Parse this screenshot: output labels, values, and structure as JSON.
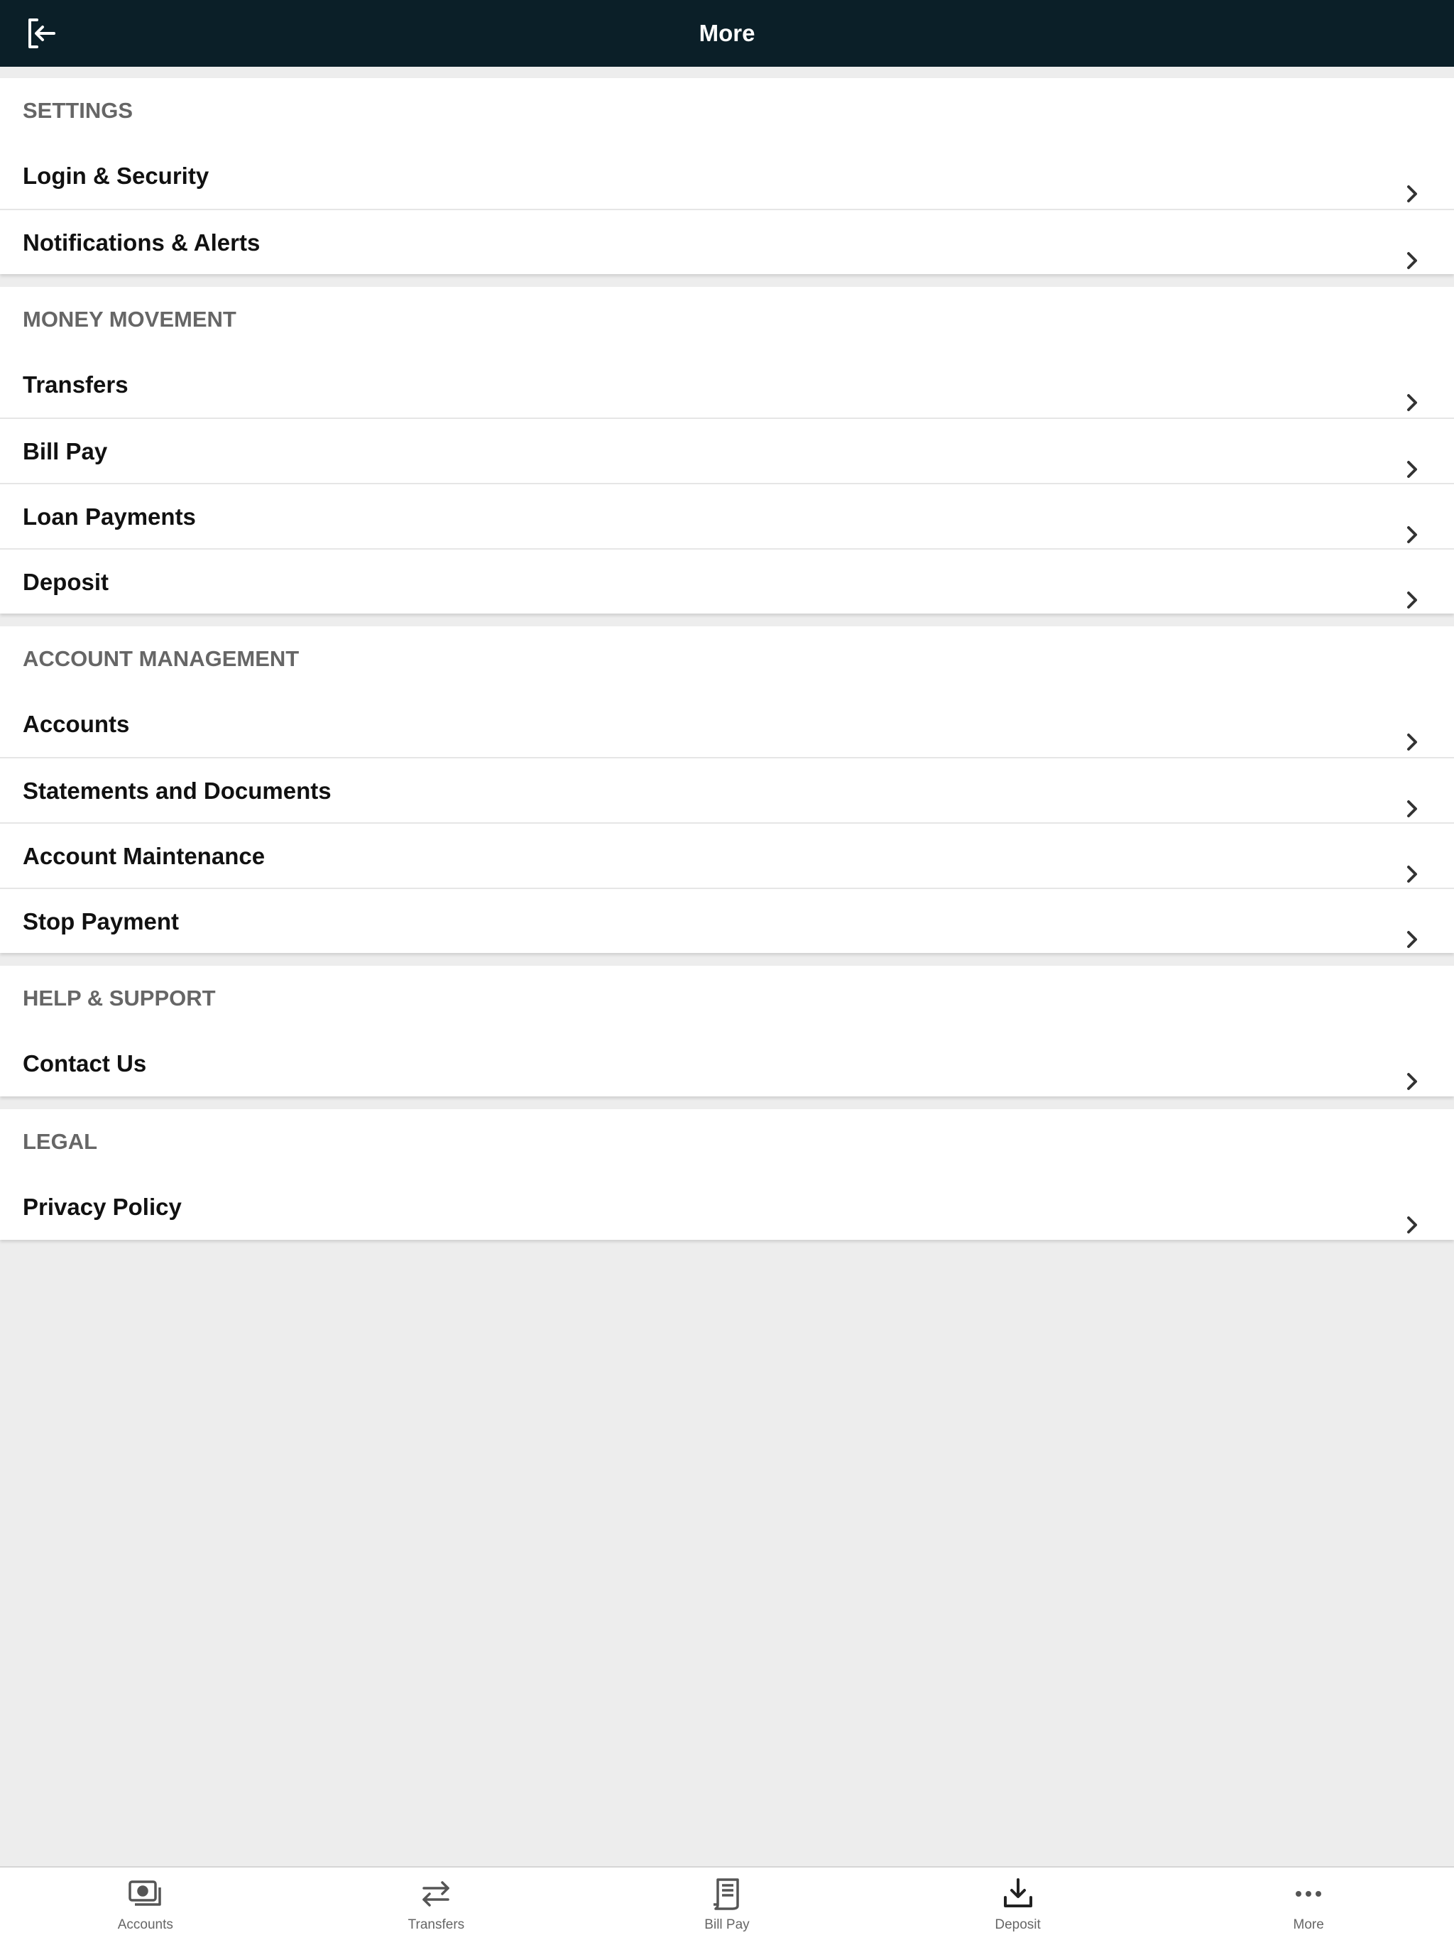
{
  "header": {
    "title": "More",
    "logout_icon": "logout-icon"
  },
  "sections": [
    {
      "title": "SETTINGS",
      "items": [
        {
          "label": "Login & Security"
        },
        {
          "label": "Notifications & Alerts"
        }
      ]
    },
    {
      "title": "MONEY MOVEMENT",
      "items": [
        {
          "label": "Transfers"
        },
        {
          "label": "Bill Pay"
        },
        {
          "label": "Loan Payments"
        },
        {
          "label": "Deposit"
        }
      ]
    },
    {
      "title": "ACCOUNT MANAGEMENT",
      "items": [
        {
          "label": "Accounts"
        },
        {
          "label": "Statements and Documents"
        },
        {
          "label": "Account Maintenance"
        },
        {
          "label": "Stop Payment"
        }
      ]
    },
    {
      "title": "HELP & SUPPORT",
      "items": [
        {
          "label": "Contact Us"
        }
      ]
    },
    {
      "title": "LEGAL",
      "items": [
        {
          "label": "Privacy Policy"
        }
      ]
    }
  ],
  "tabbar": {
    "tabs": [
      {
        "label": "Accounts",
        "icon": "accounts-icon"
      },
      {
        "label": "Transfers",
        "icon": "transfers-icon"
      },
      {
        "label": "Bill Pay",
        "icon": "bill-pay-icon"
      },
      {
        "label": "Deposit",
        "icon": "deposit-icon"
      },
      {
        "label": "More",
        "icon": "more-icon"
      }
    ]
  },
  "colors": {
    "header_bg": "#0b1f28",
    "section_title": "#666666",
    "row_text": "#111111",
    "page_bg": "#ededed"
  }
}
